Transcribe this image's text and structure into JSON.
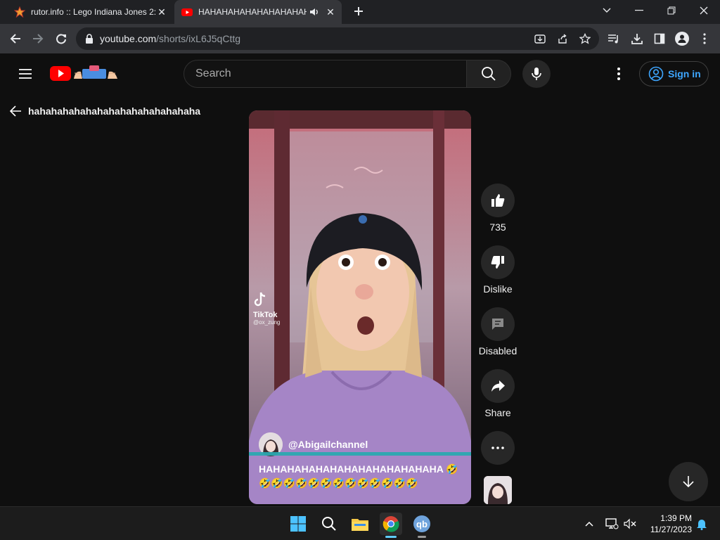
{
  "browser": {
    "tabs": [
      {
        "title": "rutor.info :: Lego Indiana Jones 2: ...",
        "favicon": "rutor-icon",
        "active": false
      },
      {
        "title": "HAHAHAHAHAHAHAHAHAHAHA",
        "favicon": "youtube-icon",
        "active": true,
        "playing_audio": true
      }
    ],
    "new_tab_icon": "plus-icon",
    "url_host": "youtube.com",
    "url_path": "/shorts/ixL6J5qCttg"
  },
  "youtube": {
    "search_placeholder": "Search",
    "sign_in_label": "Sign in",
    "accent_color": "#3ea6ff"
  },
  "short": {
    "back_title": "hahahahahahahahahahahahahahaha",
    "watermark_brand": "TikTok",
    "watermark_user": "@ox_zung",
    "channel_name": "@Abigailchannel",
    "caption_line1": "HAHAHAHAHAHAHAHAHAHAHAHAHA",
    "caption_line1_emoji": "🤣",
    "caption_line2": "🤣🤣🤣🤣🤣🤣🤣🤣🤣🤣🤣🤣🤣",
    "actions": {
      "like_count": "735",
      "dislike_label": "Dislike",
      "comments_label": "Disabled",
      "share_label": "Share"
    }
  },
  "taskbar": {
    "time": "1:39 PM",
    "date": "11/27/2023",
    "pinned": [
      "windows-start-icon",
      "search-icon",
      "file-explorer-icon",
      "chrome-icon",
      "qbittorrent-icon"
    ]
  }
}
